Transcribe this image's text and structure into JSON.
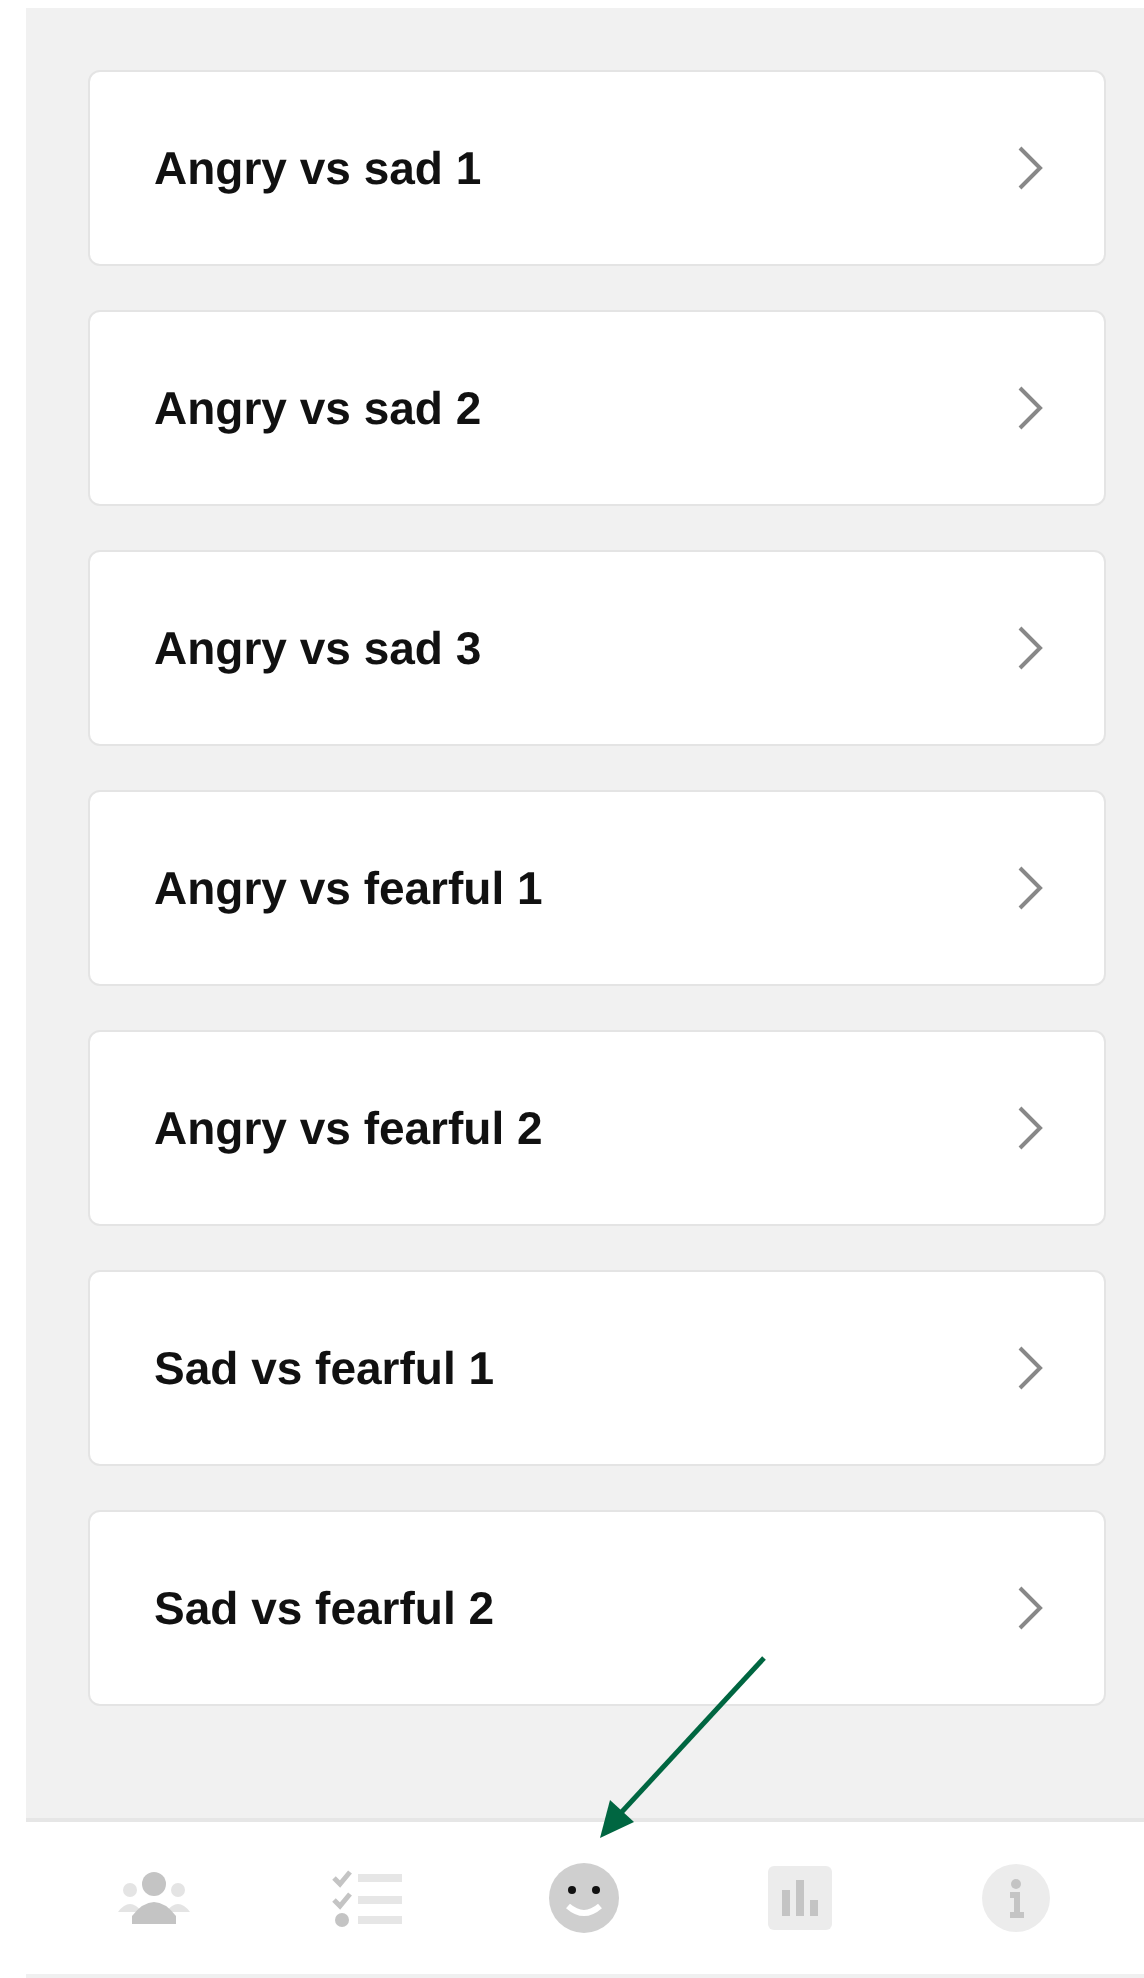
{
  "items": [
    {
      "label": "Angry vs sad 1"
    },
    {
      "label": "Angry vs sad 2"
    },
    {
      "label": "Angry vs sad 3"
    },
    {
      "label": "Angry vs fearful 1"
    },
    {
      "label": "Angry vs fearful 2"
    },
    {
      "label": "Sad vs fearful 1"
    },
    {
      "label": "Sad vs fearful 2"
    }
  ],
  "nav": [
    {
      "kind": "people",
      "selected": false
    },
    {
      "kind": "checklist",
      "selected": false
    },
    {
      "kind": "smiley",
      "selected": true
    },
    {
      "kind": "chart",
      "selected": false
    },
    {
      "kind": "info",
      "selected": false
    }
  ]
}
